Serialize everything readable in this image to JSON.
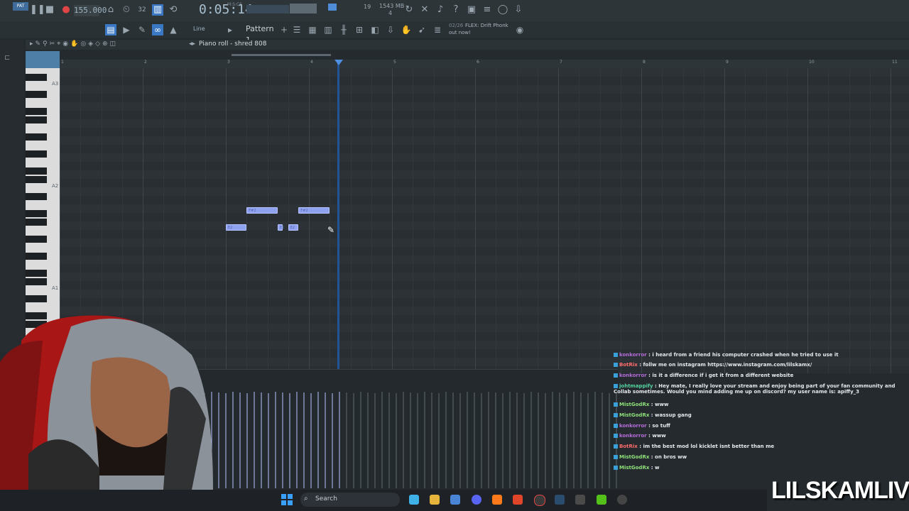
{
  "transport": {
    "tempo": "155.000",
    "timecode": "0:05:14",
    "timecode_unit": "M:S:CS",
    "cpu_mem": "1543 MB",
    "cpu_sub": "4",
    "voices": "19",
    "pattern_label": "Pattern 1",
    "line_mode": "Line"
  },
  "news": {
    "date": "02/26",
    "title": "FLEX: Drift Phonk",
    "subtitle": "out now!"
  },
  "piano_roll": {
    "title": "Piano roll - shred 808",
    "bar_numbers": [
      "1",
      "2",
      "3",
      "4",
      "5",
      "6",
      "7",
      "8",
      "9",
      "10",
      "11"
    ],
    "key_labels": [
      "A3",
      "A2",
      "A1"
    ],
    "notes": [
      {
        "label": "F#2",
        "row": "upper",
        "start": 3.25,
        "len": 0.375
      },
      {
        "label": "F#2",
        "row": "upper",
        "start": 3.875,
        "len": 0.375
      },
      {
        "label": "E2",
        "row": "lower",
        "start": 3.0,
        "len": 0.25
      },
      {
        "label": "E2",
        "row": "lower",
        "start": 3.625,
        "len": 0.0625
      },
      {
        "label": "E2",
        "row": "lower",
        "start": 3.75,
        "len": 0.125
      }
    ]
  },
  "chat": [
    {
      "user": "konkorror",
      "text": "i heard from a friend his computer crashed when he tried to use it",
      "user_color": "#b46cd8"
    },
    {
      "user": "BotRix",
      "text": "follw me on instagram https://www.instagram.com/lilskamx/",
      "user_color": "#ff6b6b"
    },
    {
      "user": "konkorror",
      "text": "is it a difference if i get it from a different website",
      "user_color": "#b46cd8"
    },
    {
      "user": "johtmappify",
      "text": "Hey mate, I really love your stream and enjoy being part of your fan community and Collab sometimes. Would you mind adding me up on discord? my user name is: apiffy_3",
      "user_color": "#54d2a0"
    },
    {
      "user": "MistGodRx",
      "text": "www",
      "user_color": "#8fe07a"
    },
    {
      "user": "MistGodRx",
      "text": "wassup gang",
      "user_color": "#8fe07a"
    },
    {
      "user": "konkorror",
      "text": "so tuff",
      "user_color": "#b46cd8"
    },
    {
      "user": "konkorror",
      "text": "www",
      "user_color": "#b46cd8"
    },
    {
      "user": "BotRix",
      "text": "im the best mod lol kicklet isnt better than me",
      "user_color": "#ff6b6b"
    },
    {
      "user": "MistGodRx",
      "text": "on bros ww",
      "user_color": "#8fe07a"
    },
    {
      "user": "MistGodRx",
      "text": "w",
      "user_color": "#8fe07a"
    }
  ],
  "taskbar": {
    "search_placeholder": "Search"
  },
  "brand": "LILSKAMLIVE",
  "colors": {
    "accent": "#1f5aa8",
    "note": "#8fa2f0"
  }
}
